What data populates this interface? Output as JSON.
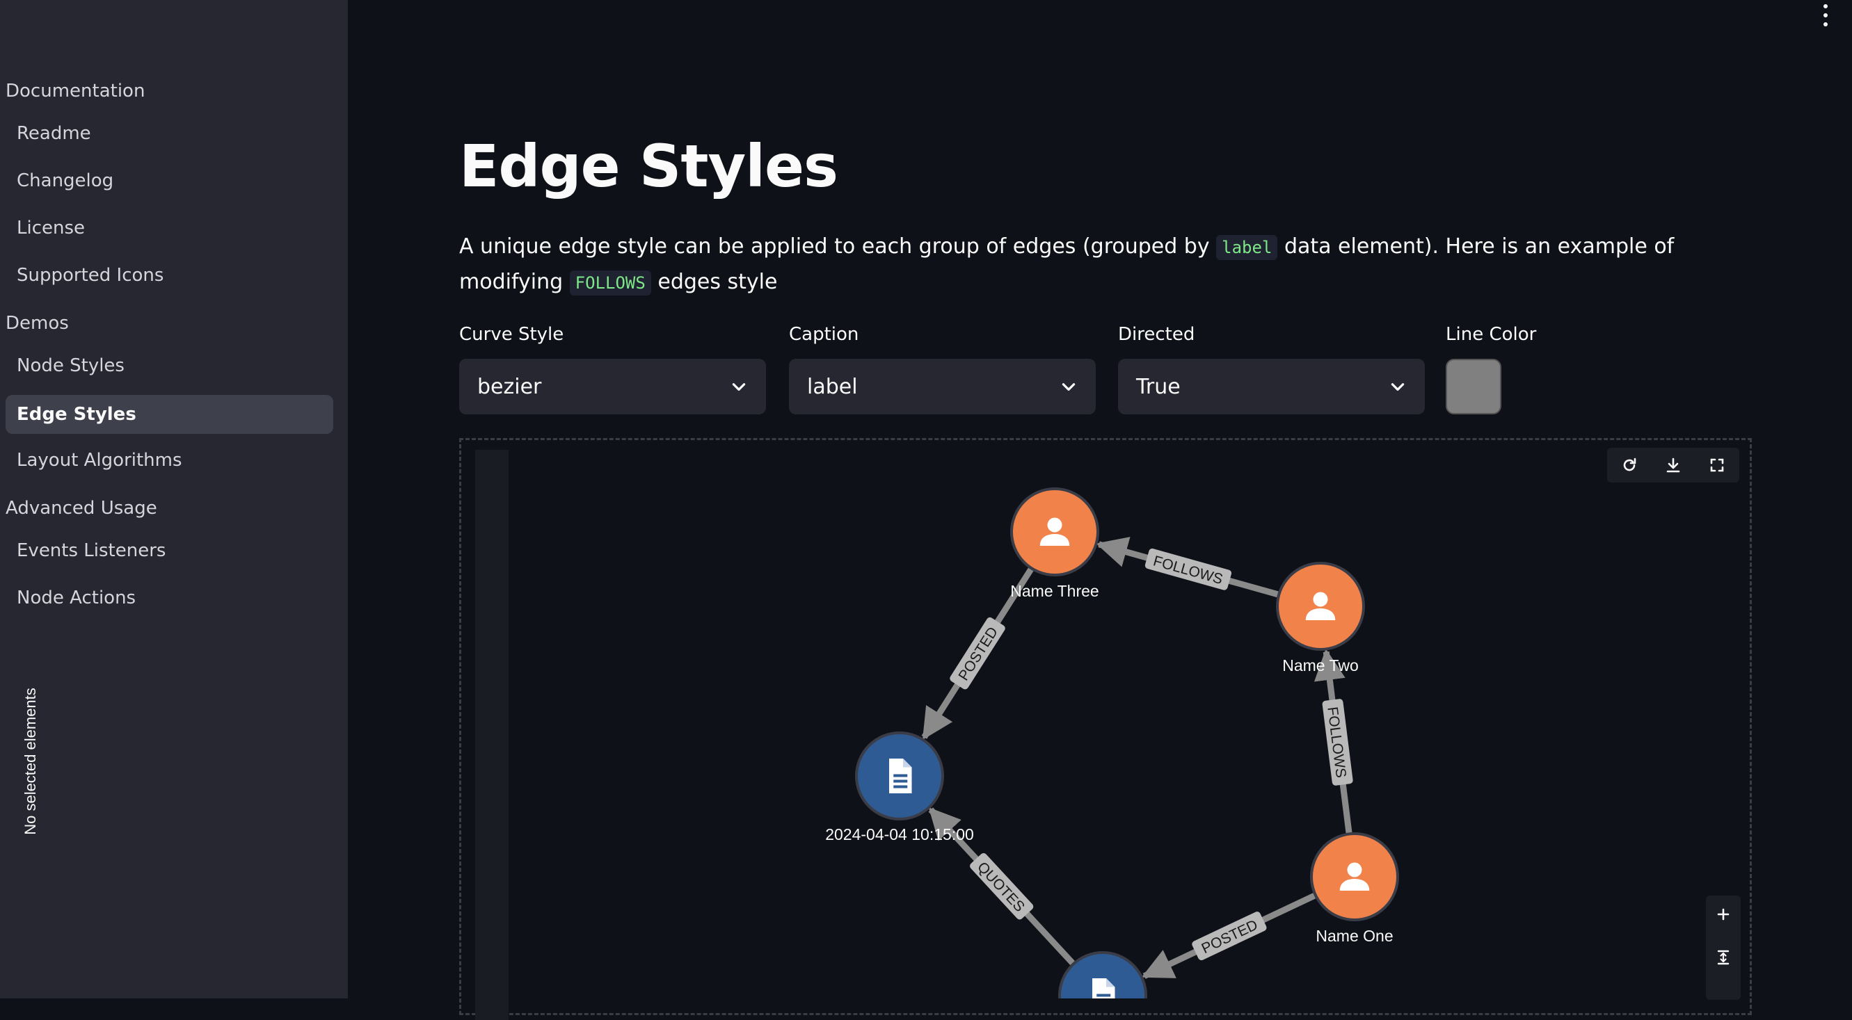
{
  "sidebar": {
    "sections": [
      {
        "label": "Documentation",
        "items": [
          "Readme",
          "Changelog",
          "License",
          "Supported Icons"
        ]
      },
      {
        "label": "Demos",
        "items": [
          "Node Styles",
          "Edge Styles",
          "Layout Algorithms"
        ]
      },
      {
        "label": "Advanced Usage",
        "items": [
          "Events Listeners",
          "Node Actions"
        ]
      }
    ],
    "active_item": "Edge Styles"
  },
  "page": {
    "title": "Edge Styles",
    "desc_part1": "A unique edge style can be applied to each group of edges (grouped by ",
    "desc_code1": "label",
    "desc_part2": " data element). Here is an example of modifying ",
    "desc_code2": "FOLLOWS",
    "desc_part3": " edges style"
  },
  "controls": {
    "curve_style": {
      "label": "Curve Style",
      "value": "bezier"
    },
    "caption": {
      "label": "Caption",
      "value": "label"
    },
    "directed": {
      "label": "Directed",
      "value": "True"
    },
    "line_color": {
      "label": "Line Color",
      "value": "#808080"
    }
  },
  "graph": {
    "side_panel_text": "No selected elements",
    "toolbar": [
      "refresh-icon",
      "download-icon",
      "fullscreen-icon"
    ],
    "zoom": [
      "zoom-in-icon",
      "fit-icon"
    ],
    "colors": {
      "person": "#f0824a",
      "post": "#2f5b94",
      "edge": "#8a8a8a",
      "background": "#0e1117"
    },
    "nodes": [
      {
        "id": "three",
        "type": "person",
        "label": "Name Three"
      },
      {
        "id": "two",
        "type": "person",
        "label": "Name Two"
      },
      {
        "id": "one",
        "type": "person",
        "label": "Name One"
      },
      {
        "id": "post1",
        "type": "post",
        "label": "2024-04-04 10:15:00"
      },
      {
        "id": "post2",
        "type": "post",
        "label": ""
      }
    ],
    "edges": [
      {
        "from": "two",
        "to": "three",
        "label": "FOLLOWS"
      },
      {
        "from": "one",
        "to": "two",
        "label": "FOLLOWS"
      },
      {
        "from": "three",
        "to": "post1",
        "label": "POSTED"
      },
      {
        "from": "post2",
        "to": "post1",
        "label": "QUOTES"
      },
      {
        "from": "one",
        "to": "post2",
        "label": "POSTED"
      }
    ]
  }
}
